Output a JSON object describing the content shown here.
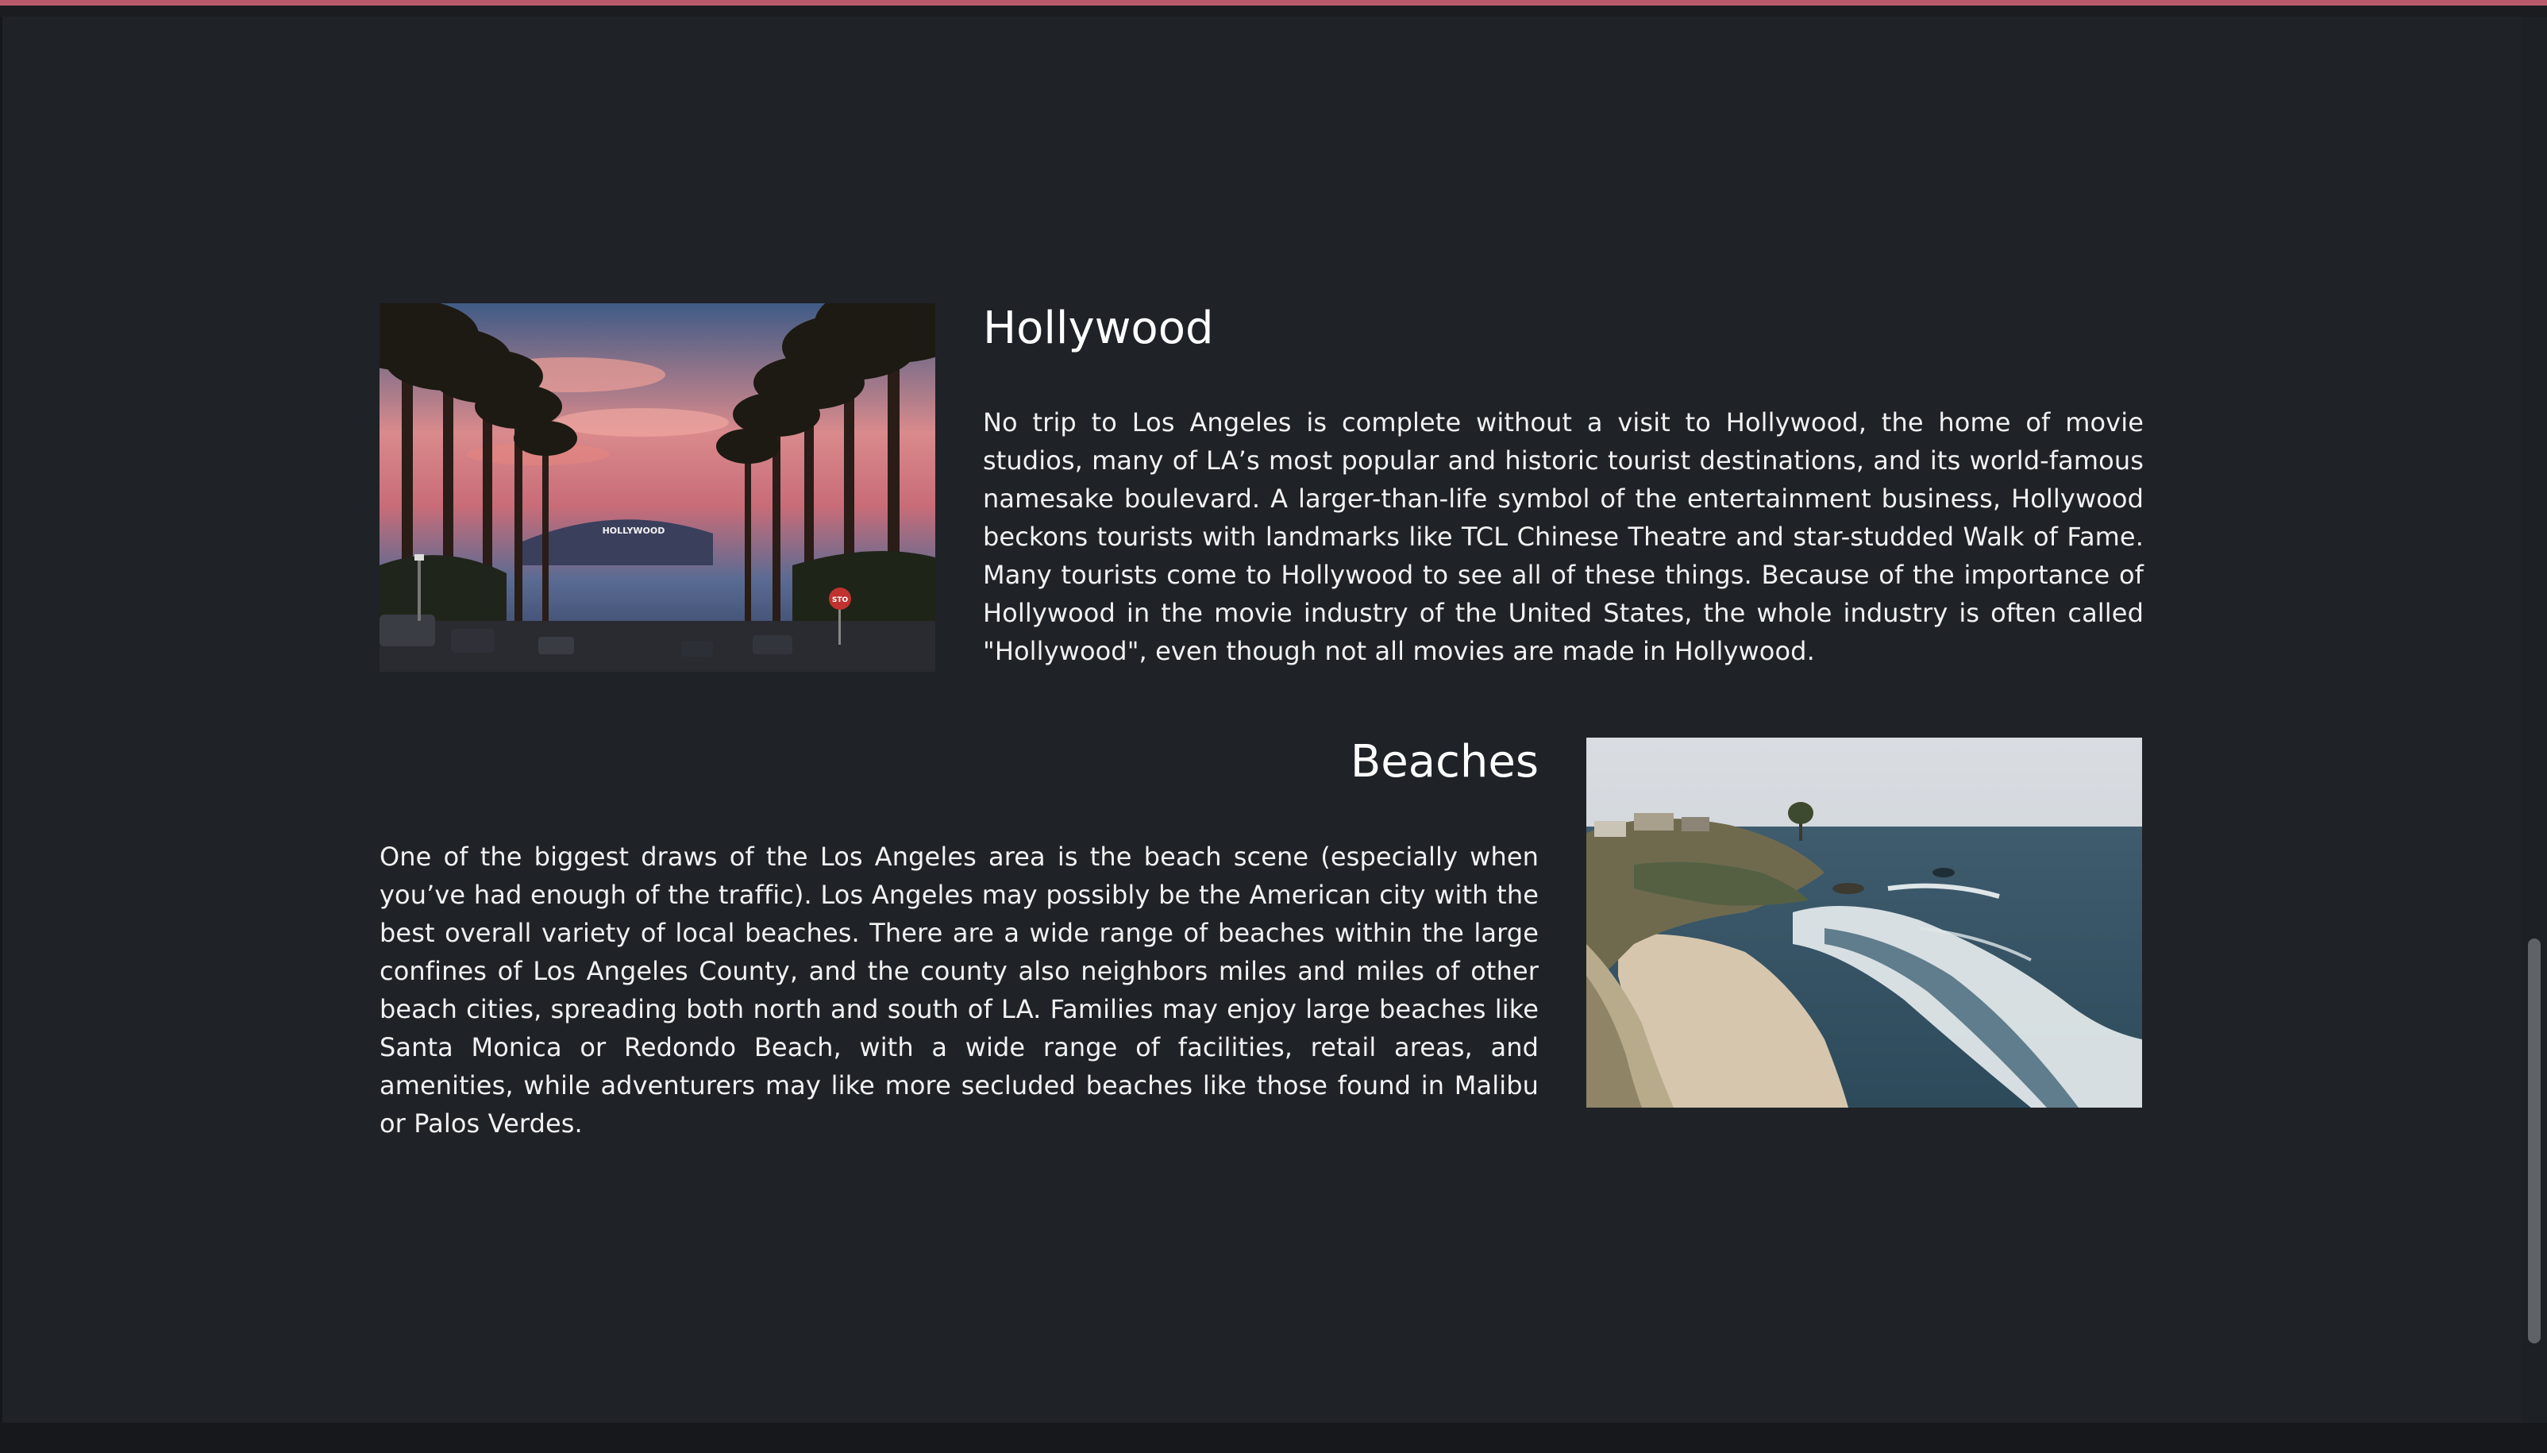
{
  "sections": [
    {
      "title": "Hollywood",
      "text": "No trip to Los Angeles is complete without a visit to Hollywood, the home of movie studios, many of LA’s most popular and historic tourist destinations, and its world-famous namesake boulevard. A larger-than-life symbol of the entertainment business, Hollywood beckons tourists with landmarks like TCL Chinese Theatre and star-studded Walk of Fame. Many tourists come to Hollywood to see all of these things. Because of the importance of Hollywood in the movie industry of the United States, the whole industry is often called \"Hollywood\", even though not all movies are made in Hollywood.",
      "image": {
        "subject": "palm-lined street at sunset with the Hollywood sign",
        "sign_text": "HOLLYWOOD",
        "stop_sign_text": "STO"
      }
    },
    {
      "title": "Beaches",
      "text": "One of the biggest draws of the Los Angeles area is the beach scene (especially when you’ve had enough of the traffic). Los Angeles may possibly be the American city with the best overall variety of local beaches. There are a wide range of beaches within the large confines of Los Angeles County, and the county also neighbors miles and miles of other beach cities, spreading both north and south of LA. Families may enjoy large beaches like Santa Monica or Redondo Beach, with a wide range of facilities, retail areas, and amenities, while adventurers may like more secluded beaches like those found in Malibu or Palos Verdes.",
      "image": {
        "subject": "coastal cliffs and sandy cove with ocean waves"
      }
    }
  ],
  "colors": {
    "background": "#1f2227",
    "accent_top": "#b85a6c",
    "text": "#f2f2f2",
    "scrollbar_thumb": "#5f6368"
  }
}
